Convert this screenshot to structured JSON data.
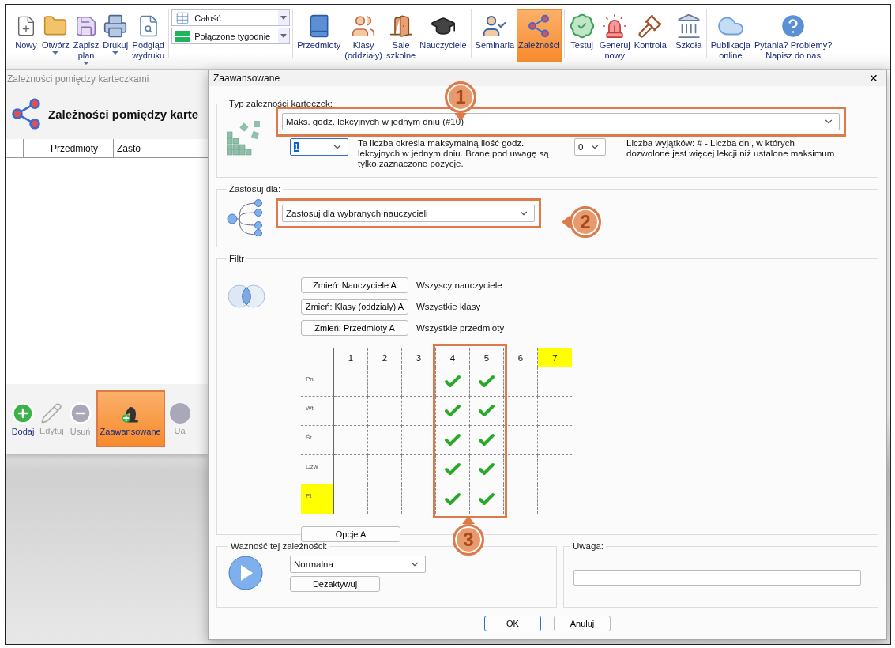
{
  "toolbar": {
    "groups": [
      {
        "kind": "buttons",
        "items": [
          {
            "label": "Nowy",
            "has_menu": false,
            "selected": false
          },
          {
            "label": "Otwórz",
            "has_menu": true,
            "selected": false
          },
          {
            "label": "Zapisz\nplan",
            "has_menu": true,
            "selected": false
          },
          {
            "label": "Drukuj",
            "has_menu": true,
            "selected": false
          },
          {
            "label": "Podgląd\nwydruku",
            "has_menu": false,
            "selected": false
          }
        ]
      },
      {
        "kind": "dropdowns",
        "items": [
          {
            "value": "Całość"
          },
          {
            "value": "Połączone tygodnie"
          }
        ]
      },
      {
        "kind": "buttons",
        "items": [
          {
            "label": "Przedmioty",
            "has_menu": false,
            "selected": false
          },
          {
            "label": "Klasy\n(oddziały)",
            "has_menu": false,
            "selected": false
          },
          {
            "label": "Sale\nszkolne",
            "has_menu": false,
            "selected": false
          },
          {
            "label": "Nauczyciele",
            "has_menu": false,
            "selected": false
          }
        ]
      },
      {
        "kind": "buttons",
        "items": [
          {
            "label": "Seminaria",
            "has_menu": false,
            "selected": false
          },
          {
            "label": "Zależności",
            "has_menu": false,
            "selected": true
          }
        ]
      },
      {
        "kind": "buttons",
        "items": [
          {
            "label": "Testuj",
            "has_menu": false,
            "selected": false
          },
          {
            "label": "Generuj\nnowy",
            "has_menu": false,
            "selected": false
          },
          {
            "label": "Kontrola",
            "has_menu": false,
            "selected": false
          }
        ]
      },
      {
        "kind": "buttons",
        "items": [
          {
            "label": "Szkoła",
            "has_menu": false,
            "selected": false
          }
        ]
      },
      {
        "kind": "buttons",
        "items": [
          {
            "label": "Publikacja\nonline",
            "has_menu": false,
            "selected": false
          },
          {
            "label": "Pytania? Problemy?\nNapisz do nas",
            "has_menu": false,
            "selected": false
          }
        ]
      }
    ]
  },
  "background_window": {
    "title": "Zależności pomiędzy karteczkami",
    "heading": "Zależności pomiędzy karte",
    "columns": [
      "",
      "",
      "Przedmioty",
      "Zasto"
    ],
    "actions": [
      {
        "label": "Dodaj",
        "disabled": false,
        "selected": false
      },
      {
        "label": "Edytuj",
        "disabled": true,
        "selected": false
      },
      {
        "label": "Usuń",
        "disabled": true,
        "selected": false
      },
      {
        "label": "Zaawansowane",
        "disabled": false,
        "selected": true
      },
      {
        "label": "Ua",
        "disabled": true,
        "selected": false
      }
    ]
  },
  "dialog": {
    "title": "Zaawansowane",
    "close": "✕",
    "type_section": {
      "legend": "Typ zależności karteczek:",
      "select": "Maks. godz. lekcyjnych w jednym dniu (#10)",
      "max_value": "1",
      "max_text": "Ta liczba określa maksymalną ilość godz. lekcyjnych w jednym dniu. Brane pod uwagę są tylko zaznaczone pozycje.",
      "exceptions_value": "0",
      "exceptions_text": "Liczba wyjątków: # - Liczba dni, w których dozwolone jest więcej lekcji niż ustalone maksimum"
    },
    "apply_section": {
      "legend": "Zastosuj dla:",
      "select": "Zastosuj dla wybranych nauczycieli"
    },
    "filter_section": {
      "legend": "Filtr",
      "filters": [
        {
          "button": "Zmień: Nauczyciele A",
          "value": "Wszyscy nauczyciele"
        },
        {
          "button": "Zmień: Klasy (oddziały) A",
          "value": "Wszystkie klasy"
        },
        {
          "button": "Zmień: Przedmioty A",
          "value": "Wszystkie przedmioty"
        }
      ],
      "grid": {
        "columns": [
          {
            "label": "1",
            "highlighted": false
          },
          {
            "label": "2",
            "highlighted": false
          },
          {
            "label": "3",
            "highlighted": false
          },
          {
            "label": "4",
            "highlighted": false
          },
          {
            "label": "5",
            "highlighted": false
          },
          {
            "label": "6",
            "highlighted": false
          },
          {
            "label": "7",
            "highlighted": true
          }
        ],
        "rows": [
          {
            "label": "Pn",
            "highlighted": false,
            "cells": [
              {
                "checked": false
              },
              {
                "checked": false
              },
              {
                "checked": false
              },
              {
                "checked": true
              },
              {
                "checked": true
              },
              {
                "checked": false
              },
              {
                "checked": false
              }
            ]
          },
          {
            "label": "Wt",
            "highlighted": false,
            "cells": [
              {
                "checked": false
              },
              {
                "checked": false
              },
              {
                "checked": false
              },
              {
                "checked": true
              },
              {
                "checked": true
              },
              {
                "checked": false
              },
              {
                "checked": false
              }
            ]
          },
          {
            "label": "Śr",
            "highlighted": false,
            "cells": [
              {
                "checked": false
              },
              {
                "checked": false
              },
              {
                "checked": false
              },
              {
                "checked": true
              },
              {
                "checked": true
              },
              {
                "checked": false
              },
              {
                "checked": false
              }
            ]
          },
          {
            "label": "Czw",
            "highlighted": false,
            "cells": [
              {
                "checked": false
              },
              {
                "checked": false
              },
              {
                "checked": false
              },
              {
                "checked": true
              },
              {
                "checked": true
              },
              {
                "checked": false
              },
              {
                "checked": false
              }
            ]
          },
          {
            "label": "Pt",
            "highlighted": true,
            "cells": [
              {
                "checked": false
              },
              {
                "checked": false
              },
              {
                "checked": false
              },
              {
                "checked": true
              },
              {
                "checked": true
              },
              {
                "checked": false
              },
              {
                "checked": false
              }
            ]
          }
        ]
      },
      "options_button": "Opcje A"
    },
    "importance_section": {
      "legend": "Ważność tej zależności:",
      "select": "Normalna",
      "button": "Dezaktywuj"
    },
    "note_section": {
      "legend": "Uwaga:"
    },
    "buttons": [
      {
        "label": "OK",
        "default": true
      },
      {
        "label": "Anuluj",
        "default": false
      }
    ]
  },
  "callouts": [
    "1",
    "2",
    "3"
  ]
}
